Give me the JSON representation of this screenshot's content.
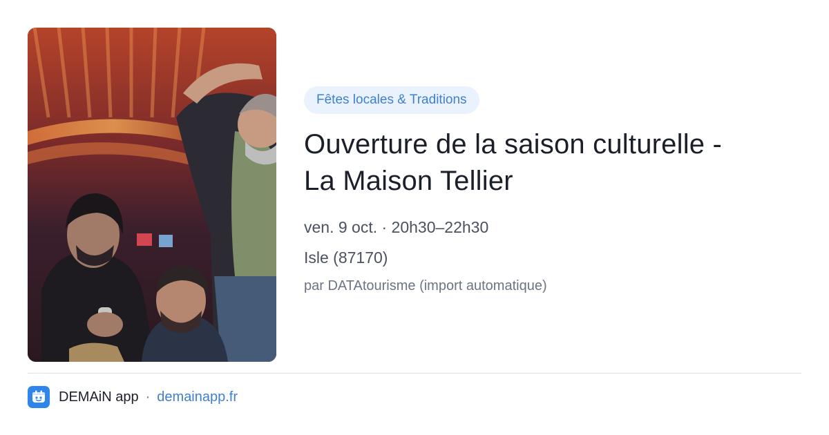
{
  "event": {
    "category": "Fêtes locales & Traditions",
    "title_line1": "Ouverture de la saison culturelle -",
    "title_line2": "La Maison Tellier",
    "datetime": "ven. 9 oct. · 20h30–22h30",
    "location": "Isle (87170)",
    "source": "par DATAtourisme (import automatique)",
    "image_description": "photo-of-band-members"
  },
  "footer": {
    "app_name": "DEMAiN app",
    "separator": "·",
    "link_text": "demainapp.fr",
    "app_icon": "demain-app-icon"
  },
  "colors": {
    "accent": "#3f7fcf",
    "pill_background": "#eaf2fd",
    "title": "#1b1f2a",
    "secondary_text": "#4a5160",
    "muted_text": "#6c7483",
    "divider": "#dde1e6",
    "app_icon_background": "#2f86e8"
  }
}
